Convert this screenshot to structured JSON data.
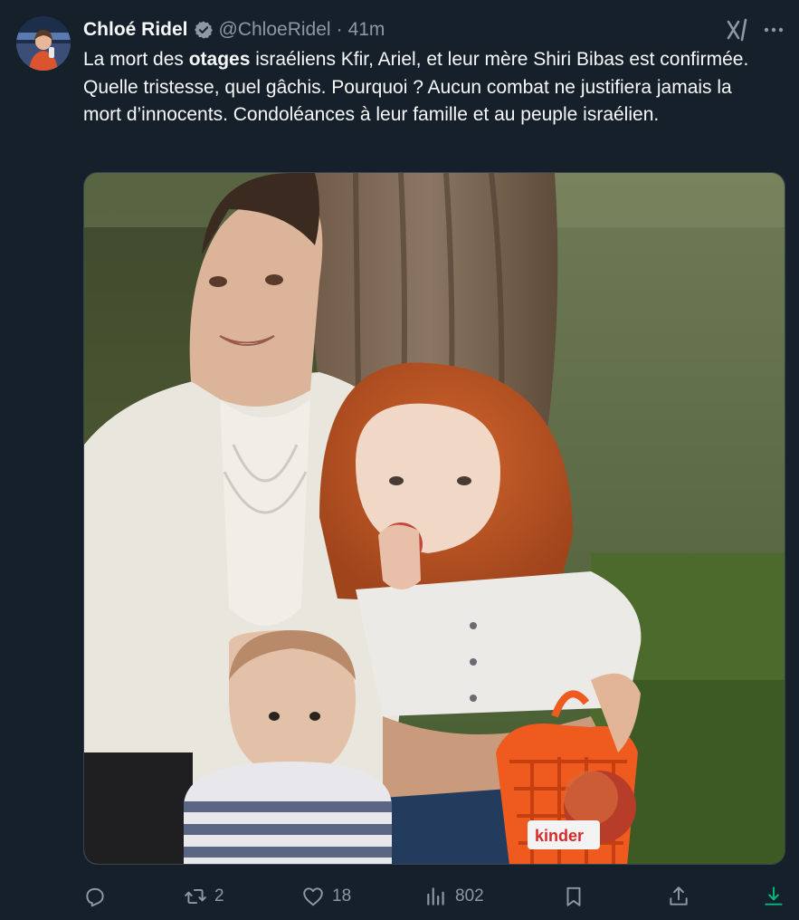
{
  "author": {
    "display_name": "Chloé Ridel",
    "handle": "@ChloeRidel",
    "separator": "·",
    "time": "41m"
  },
  "text": {
    "part1": "La mort des ",
    "bold": "otages",
    "part2": " israéliens Kfir, Ariel, et leur mère Shiri Bibas est confirmée. Quelle tristesse, quel gâchis. Pourquoi ? Aucun combat ne justifiera jamais la mort d’innocents. Condoléances à leur famille et au peuple israélien."
  },
  "media": {
    "basket_label": "kinder"
  },
  "actions": {
    "reply_count": "",
    "retweet_count": "2",
    "like_count": "18",
    "views_count": "802"
  },
  "colors": {
    "background": "#15202b",
    "text": "#f7f9f9",
    "secondary": "#8b98a5",
    "verified": "#8b98a5",
    "download": "#00ba7c"
  }
}
